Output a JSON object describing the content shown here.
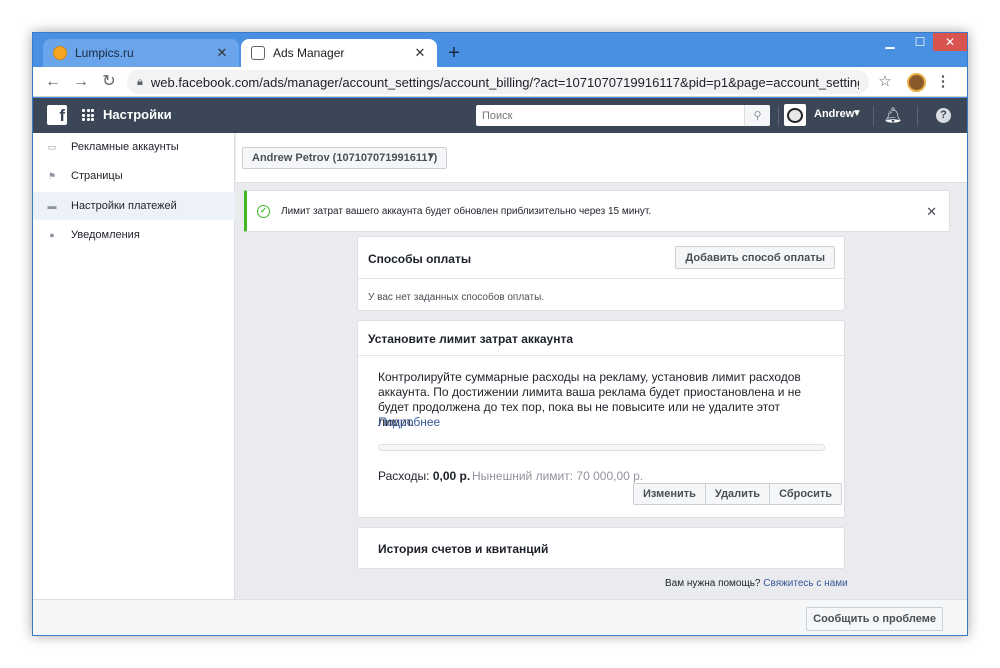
{
  "browser": {
    "tabs": [
      {
        "title": "Lumpics.ru"
      },
      {
        "title": "Ads Manager"
      }
    ],
    "new_tab": "+",
    "url": "web.facebook.com/ads/manager/account_settings/account_billing/?act=1071070719916117&pid=p1&page=account_settings&tab=accou...",
    "colors": {
      "frame": "#4a90e2",
      "close": "#d9534f"
    }
  },
  "header": {
    "title": "Настройки",
    "search_placeholder": "Поиск",
    "user_name": "Andrew",
    "colors": {
      "bar": "#3b4656"
    }
  },
  "sidebar": {
    "items": [
      {
        "label": "Рекламные аккаунты",
        "icon": "ad-account-icon"
      },
      {
        "label": "Страницы",
        "icon": "flag-icon"
      },
      {
        "label": "Настройки платежей",
        "icon": "credit-card-icon",
        "active": true
      },
      {
        "label": "Уведомления",
        "icon": "globe-icon"
      }
    ]
  },
  "account_selector": {
    "label": "Andrew Petrov (1071070719916117)"
  },
  "notice": {
    "text": "Лимит затрат вашего аккаунта будет обновлен приблизительно через 15 минут."
  },
  "payment_methods": {
    "title": "Способы оплаты",
    "add_button": "Добавить способ оплаты",
    "empty_text": "У вас нет заданных способов оплаты."
  },
  "spend_limit": {
    "title": "Установите лимит затрат аккаунта",
    "description": "Контролируйте суммарные расходы на рекламу, установив лимит расходов аккаунта. По достижении лимита ваша реклама будет приостановлена и не будет продолжена до тех пор, пока вы не повысите или не удалите этот лимит.",
    "more_link": "Подробнее",
    "progress_fraction": 0,
    "spend_label": "Расходы:",
    "spend_value": "0,00 р.",
    "current_limit": "Нынешний лимит: 70 000,00 р.",
    "buttons": {
      "change": "Изменить",
      "delete": "Удалить",
      "reset": "Сбросить"
    }
  },
  "history": {
    "title": "История счетов и квитанций"
  },
  "help": {
    "question": "Вам нужна помощь?",
    "link": "Свяжитесь с нами"
  },
  "footer": {
    "report_button": "Сообщить о проблеме"
  }
}
